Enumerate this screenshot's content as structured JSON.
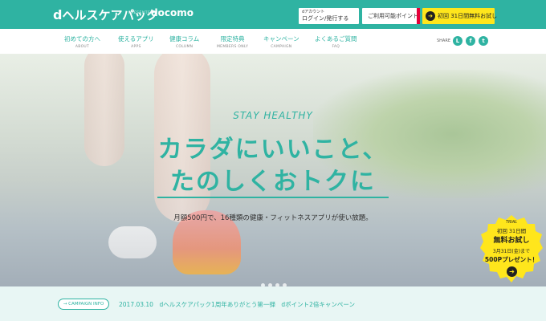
{
  "header": {
    "logo_prefix": "d",
    "logo_text": "ヘルスケアパック",
    "presented_by": "PRESENTED BY",
    "docomo": "docomo",
    "login_small": "dアカウント",
    "login_label": "ログイン/発行する",
    "points_label": "ご利用可能ポイント",
    "trial_label": "初回 31日間無料お試し",
    "accent_color": "#2fb3a2",
    "trial_color": "#ffe61c",
    "points_accent": "#e5003a"
  },
  "nav": {
    "items": [
      {
        "jp": "初めての方へ",
        "en": "ABOUT"
      },
      {
        "jp": "使えるアプリ",
        "en": "APPS"
      },
      {
        "jp": "健康コラム",
        "en": "COLUMN"
      },
      {
        "jp": "限定特典",
        "en": "MEMBERS ONLY"
      },
      {
        "jp": "キャンペーン",
        "en": "CAMPAIGN"
      },
      {
        "jp": "よくあるご質問",
        "en": "FAQ"
      }
    ],
    "share_label": "SHARE",
    "share_icons": [
      "line-icon",
      "facebook-icon",
      "twitter-icon"
    ]
  },
  "hero": {
    "eyebrow": "STAY HEALTHY",
    "headline_1": "カラダにいいこと、",
    "headline_2": "たのしくおトクに",
    "subtext": "月額500円で、16種類の健康・フィットネスアプリが使い放題。",
    "slide_count": 4,
    "active_slide": 1
  },
  "badge": {
    "trial": "TRIAL",
    "first": "初回 31日間",
    "free": "無料お試し",
    "date": "3月31日(金)まで",
    "points": "500Pプレゼント！"
  },
  "campaign": {
    "button_label": "CAMPAIGN INFO",
    "text": "2017.03.10　dヘルスケアパック1周年ありがとう第一弾　dポイント2倍キャンペーン"
  }
}
